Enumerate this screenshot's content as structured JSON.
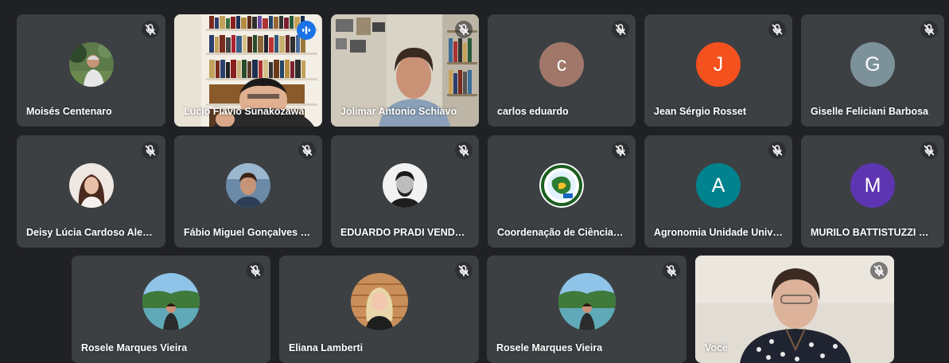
{
  "participants": [
    {
      "name": "Moisés Centenaro",
      "type": "photo"
    },
    {
      "name": "Lucio Flavio Sunakozawa",
      "type": "video",
      "speaking": true
    },
    {
      "name": "Jolimar Antonio Schiavo",
      "type": "video"
    },
    {
      "name": "carlos eduardo",
      "type": "letter",
      "letter": "c",
      "color": "#a1776a"
    },
    {
      "name": "Jean Sérgio Rosset",
      "type": "letter",
      "letter": "J",
      "color": "#f4511e"
    },
    {
      "name": "Giselle Feliciani Barbosa",
      "type": "letter",
      "letter": "G",
      "color": "#7d919b"
    },
    {
      "name": "Deisy Lúcia Cardoso Alexa...",
      "type": "photo"
    },
    {
      "name": "Fábio Miguel Gonçalves D...",
      "type": "photo"
    },
    {
      "name": "EDUARDO PRADI VENDRU...",
      "type": "photo"
    },
    {
      "name": "Coordenação de Ciências ...",
      "type": "photo"
    },
    {
      "name": "Agronomia Unidade Unive...",
      "type": "letter",
      "letter": "A",
      "color": "#00838f"
    },
    {
      "name": "MURILO BATTISTUZZI MAR...",
      "type": "letter",
      "letter": "M",
      "color": "#5e35b1"
    },
    {
      "name": "Rosele Marques Vieira",
      "type": "photo"
    },
    {
      "name": "Eliana Lamberti",
      "type": "photo"
    },
    {
      "name": "Rosele Marques Vieira",
      "type": "photo"
    },
    {
      "name": "Você",
      "type": "video"
    }
  ],
  "icons": {
    "muted": "mic-off-icon",
    "speaking": "audio-level-icon"
  },
  "colors": {
    "background": "#202124",
    "tile": "#3c4043",
    "speaking_border": "#8ab4f8",
    "speaking_badge": "#1a73e8"
  }
}
